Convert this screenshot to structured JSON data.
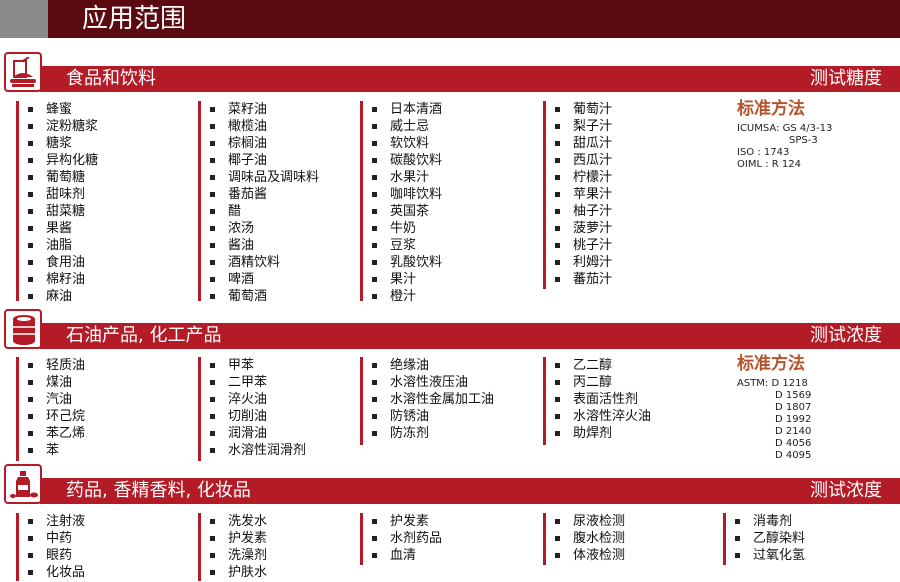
{
  "title": "应用范围",
  "sections": [
    {
      "title": "食品和饮料",
      "right": "测试糖度",
      "icon": "food-drink-icon",
      "columns": [
        [
          "蜂蜜",
          "淀粉糖浆",
          "糖浆",
          "异构化糖",
          "葡萄糖",
          "甜味剂",
          "甜菜糖",
          "果酱",
          "油脂",
          "食用油",
          "棉籽油",
          "麻油"
        ],
        [
          "菜籽油",
          "橄榄油",
          "棕榈油",
          "椰子油",
          "调味品及调味料",
          "番茄酱",
          "醋",
          "浓汤",
          "酱油",
          "酒精饮料",
          "啤酒",
          "葡萄酒"
        ],
        [
          "日本清酒",
          "威士忌",
          "软饮料",
          "碳酸饮料",
          "水果汁",
          "咖啡饮料",
          "英国茶",
          "牛奶",
          "豆浆",
          "乳酸饮料",
          "果汁",
          "橙汁"
        ],
        [
          "葡萄汁",
          "梨子汁",
          "甜瓜汁",
          "西瓜汁",
          "柠檬汁",
          "苹果汁",
          "柚子汁",
          "菠萝汁",
          "桃子汁",
          "利姆汁",
          "蕃茄汁"
        ]
      ],
      "standard": {
        "title": "标准方法",
        "lines": [
          "ICUMSA: GS 4/3-13",
          "SPS-3",
          "ISO     : 1743",
          "OIML   : R 124"
        ]
      }
    },
    {
      "title": "石油产品, 化工产品",
      "right": "测试浓度",
      "icon": "oil-barrel-icon",
      "columns": [
        [
          "轻质油",
          "煤油",
          "汽油",
          "环己烷",
          "苯乙烯",
          "苯"
        ],
        [
          "甲苯",
          "二甲苯",
          "淬火油",
          "切削油",
          "润滑油",
          "水溶性润滑剂"
        ],
        [
          "绝缘油",
          "水溶性液压油",
          "水溶性金属加工油",
          "防锈油",
          "防冻剂"
        ],
        [
          "乙二醇",
          "丙二醇",
          "表面活性剂",
          "水溶性淬火油",
          "助焊剂"
        ]
      ],
      "standard": {
        "title": "标准方法",
        "lines": [
          "ASTM: D 1218",
          "D 1569",
          "D 1807",
          "D 1992",
          "D 2140",
          "D 4056",
          "D 4095"
        ]
      }
    },
    {
      "title": "药品, 香精香料, 化妆品",
      "right": "测试浓度",
      "icon": "medicine-bottle-icon",
      "columns": [
        [
          "注射液",
          "中药",
          "眼药",
          "化妆品"
        ],
        [
          "洗发水",
          "护发素",
          "洗澡剂",
          "护肤水"
        ],
        [
          "护发素",
          "水剂药品",
          "血清"
        ],
        [
          "尿液检测",
          "腹水检测",
          "体液检测"
        ],
        [
          "消毒剂",
          "乙醇染料",
          "过氧化氢"
        ]
      ]
    }
  ]
}
